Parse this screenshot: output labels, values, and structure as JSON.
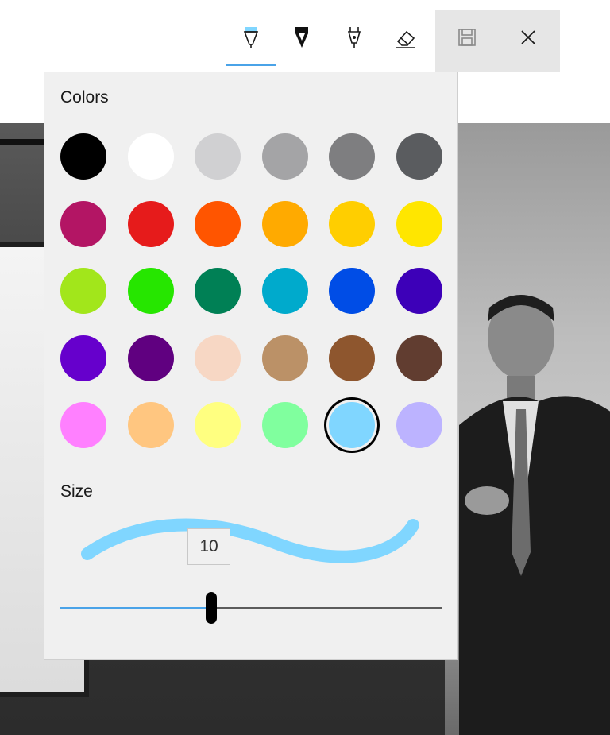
{
  "toolbar": {
    "tools": [
      {
        "name": "ballpoint-pen",
        "icon": "ballpoint-pen-icon",
        "active": true
      },
      {
        "name": "pencil",
        "icon": "pencil-icon",
        "active": false
      },
      {
        "name": "calligraphy-pen",
        "icon": "calligraphy-pen-icon",
        "active": false
      },
      {
        "name": "eraser",
        "icon": "eraser-icon",
        "active": false
      },
      {
        "name": "save",
        "icon": "save-icon",
        "active": false
      },
      {
        "name": "close",
        "icon": "close-icon",
        "active": false
      }
    ],
    "accent": "#4aa3e8"
  },
  "colors_panel": {
    "heading": "Colors",
    "palette": [
      [
        "#000000",
        "#ffffff",
        "#d0d0d2",
        "#a4a4a6",
        "#7e7e80",
        "#5a5c5f"
      ],
      [
        "#b31564",
        "#e61b1b",
        "#ff5500",
        "#ffaa00",
        "#ffce00",
        "#ffe600"
      ],
      [
        "#a2e61b",
        "#26e600",
        "#008055",
        "#00aacc",
        "#004de6",
        "#3d00b8"
      ],
      [
        "#6600cc",
        "#600080",
        "#f7d7c4",
        "#bb9167",
        "#8e562e",
        "#613d30"
      ],
      [
        "#ff80ff",
        "#ffc680",
        "#ffff80",
        "#80ff9e",
        "#80d6ff",
        "#bcb3ff"
      ]
    ],
    "selected": "#80d6ff"
  },
  "size_panel": {
    "heading": "Size",
    "value": "10",
    "slider_fraction": 0.395,
    "stroke_color": "#80d6ff"
  }
}
